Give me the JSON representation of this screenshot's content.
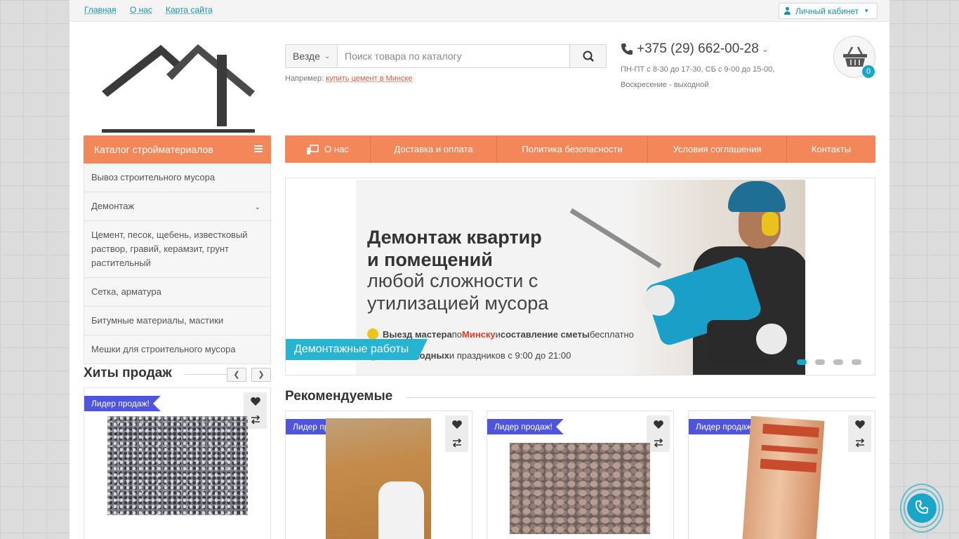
{
  "topbar": {
    "links": [
      "Главная",
      "О нас",
      "Карта сайта"
    ],
    "account_label": "Личный кабинет"
  },
  "search": {
    "scope": "Везде",
    "placeholder": "Поиск товара по каталогу",
    "example_prefix": "Например:",
    "example_link": "купить цемент в Минске"
  },
  "contacts": {
    "phone": "+375 (29) 662-00-28",
    "hours_line1": "ПН-ПТ с 8-30 до 17-30, СБ с 9-00 до 15-00,",
    "hours_line2": "Воскресение - выходной"
  },
  "cart": {
    "count": "0"
  },
  "catalog": {
    "title": "Каталог стройматериалов",
    "items": [
      "Вывоз строительного мусора",
      "Демонтаж",
      "Цемент, песок, щебень, известковый раствор, гравий, керамзит, грунт растительный",
      "Сетка, арматура",
      "Битумные материалы, мастики",
      "Мешки для строительного мусора"
    ]
  },
  "nav": {
    "items": [
      "О нас",
      "Доставка и оплата",
      "Политика безопасности",
      "Условия соглашения",
      "Контакты"
    ]
  },
  "banner": {
    "headline1": "Демонтаж квартир",
    "headline2": "и помещений",
    "sub1": "любой сложности с",
    "sub2": "утилизацией мусора",
    "bullet1_a": "Выезд мастера",
    "bullet1_b": " по ",
    "bullet1_c": "Минску",
    "bullet1_d": " и ",
    "bullet1_e": "составление сметы",
    "bullet1_f": " бесплатно",
    "bullet2_a": "Без выходных",
    "bullet2_b": " и праздников с 9:00 до 21:00",
    "caption": "Демонтажные работы",
    "slides": 4,
    "active_slide": 1
  },
  "hits": {
    "title": "Хиты продаж",
    "badge": "Лидер продаж!"
  },
  "recommended": {
    "title": "Рекомендуемые",
    "badges": [
      "Лидер продаж!",
      "Лидер продаж!",
      "Лидер продаж!"
    ]
  },
  "colors": {
    "accent_orange": "#f4875a",
    "accent_blue": "#19a6c8",
    "badge_purple": "#4f54dc",
    "link_blue": "#1a8fb8"
  }
}
